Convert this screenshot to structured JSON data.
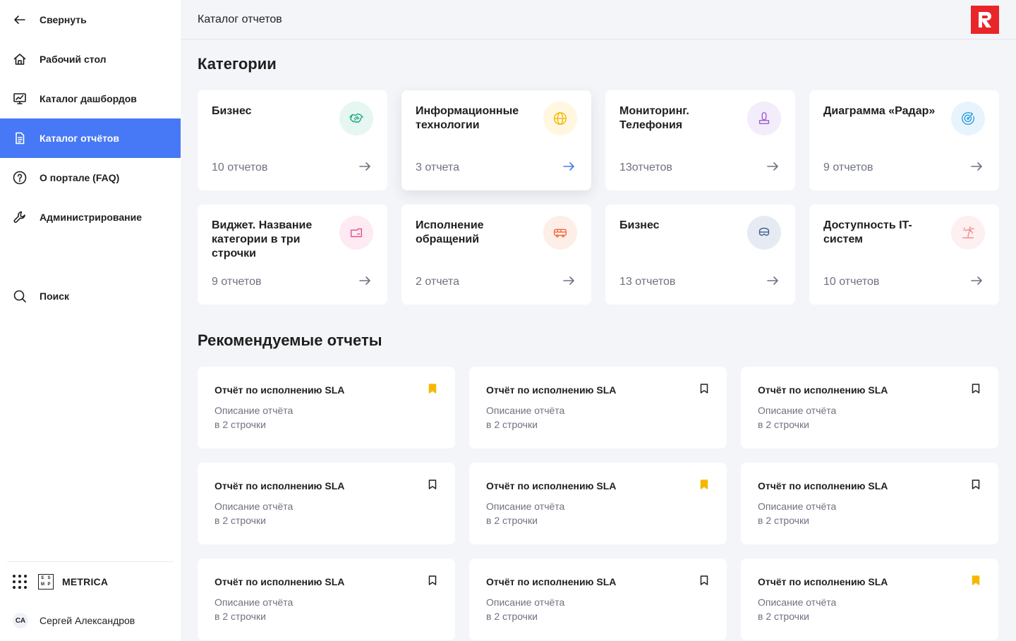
{
  "sidebar": {
    "collapse_label": "Свернуть",
    "items": [
      {
        "label": "Рабочий стол",
        "icon": "home-icon",
        "active": false
      },
      {
        "label": "Каталог дашбордов",
        "icon": "dashboard-chart-icon",
        "active": false
      },
      {
        "label": "Каталог отчётов",
        "icon": "document-icon",
        "active": true
      },
      {
        "label": "О портале (FAQ)",
        "icon": "question-circle-icon",
        "active": false
      },
      {
        "label": "Администрирование",
        "icon": "wrench-icon",
        "active": false
      }
    ],
    "search_label": "Поиск",
    "app_name": "METRICA",
    "app_logo_letters": [
      "E",
      "S",
      "M",
      "P"
    ],
    "user": {
      "initials": "СА",
      "name": "Сергей Александров"
    }
  },
  "header": {
    "title": "Каталог отчетов",
    "brand_color": "#e8262a"
  },
  "accent_color": "#4778f5",
  "categories_section": {
    "title": "Категории",
    "cards": [
      {
        "name": "Бизнес",
        "count": "10 отчетов",
        "icon": "handshake-icon",
        "icon_color": "#1aa883",
        "icon_bg": "#e6f6f1"
      },
      {
        "name": "Информационные технологии",
        "count": "3 отчета",
        "icon": "globe-icon",
        "icon_color": "#f2b705",
        "icon_bg": "#fff7e0"
      },
      {
        "name": "Мониторинг. Телефония",
        "count": "13отчетов",
        "icon": "telephone-icon",
        "icon_color": "#9b59d0",
        "icon_bg": "#f3ecfb"
      },
      {
        "name": "Диаграмма «Радар»",
        "count": "9 отчетов",
        "icon": "radar-target-icon",
        "icon_color": "#2d9cdb",
        "icon_bg": "#e8f4fc"
      },
      {
        "name": "Виджет. Название категории в три строчки",
        "count": "9 отчетов",
        "icon": "widget-window-icon",
        "icon_color": "#e34b8a",
        "icon_bg": "#fdeaf2"
      },
      {
        "name": "Исполнение обращений",
        "count": "2 отчета",
        "icon": "bus-icon",
        "icon_color": "#f2683c",
        "icon_bg": "#fdeee8"
      },
      {
        "name": "Бизнес",
        "count": "13 отчетов",
        "icon": "diving-mask-icon",
        "icon_color": "#3a5a8c",
        "icon_bg": "#e6ebf3"
      },
      {
        "name": "Доступность IT-систем",
        "count": "10 отчетов",
        "icon": "palm-island-icon",
        "icon_color": "#f08a8a",
        "icon_bg": "#fdf0f0"
      }
    ]
  },
  "recommended_section": {
    "title": "Рекомендуемые отчеты",
    "reports": [
      {
        "title": "Отчёт по исполнению SLA",
        "desc_line1": "Описание отчёта",
        "desc_line2": "в 2 строчки",
        "bookmarked": true
      },
      {
        "title": "Отчёт по исполнению SLA",
        "desc_line1": "Описание отчёта",
        "desc_line2": "в 2 строчки",
        "bookmarked": false
      },
      {
        "title": "Отчёт по исполнению SLA",
        "desc_line1": "Описание отчёта",
        "desc_line2": "в 2 строчки",
        "bookmarked": false
      },
      {
        "title": "Отчёт по исполнению SLA",
        "desc_line1": "Описание отчёта",
        "desc_line2": "в 2 строчки",
        "bookmarked": false
      },
      {
        "title": "Отчёт по исполнению SLA",
        "desc_line1": "Описание отчёта",
        "desc_line2": "в 2 строчки",
        "bookmarked": true
      },
      {
        "title": "Отчёт по исполнению SLA",
        "desc_line1": "Описание отчёта",
        "desc_line2": "в 2 строчки",
        "bookmarked": false
      },
      {
        "title": "Отчёт по исполнению SLA",
        "desc_line1": "Описание отчёта",
        "desc_line2": "в 2 строчки",
        "bookmarked": false
      },
      {
        "title": "Отчёт по исполнению SLA",
        "desc_line1": "Описание отчёта",
        "desc_line2": "в 2 строчки",
        "bookmarked": false
      },
      {
        "title": "Отчёт по исполнению SLA",
        "desc_line1": "Описание отчёта",
        "desc_line2": "в 2 строчки",
        "bookmarked": true
      }
    ],
    "bookmark_active_color": "#f5b800"
  }
}
